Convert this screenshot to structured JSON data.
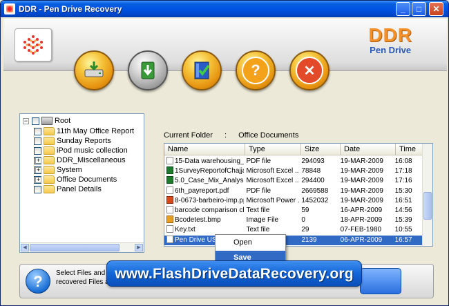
{
  "window": {
    "title": "DDR - Pen Drive Recovery",
    "minimize_label": "_",
    "maximize_label": "□",
    "close_label": "✕"
  },
  "brand": {
    "name": "DDR",
    "product": "Pen Drive"
  },
  "toolbar": {
    "buttons": [
      {
        "icon": "recover-drive-icon"
      },
      {
        "icon": "save-download-icon"
      },
      {
        "icon": "book-check-icon"
      },
      {
        "icon": "help-icon"
      },
      {
        "icon": "exit-icon"
      }
    ]
  },
  "tree": {
    "root_label": "Root",
    "items": [
      {
        "label": "11th May Office Report",
        "expandable": false
      },
      {
        "label": "Sunday Reports",
        "expandable": false
      },
      {
        "label": "iPod music collection",
        "expandable": false
      },
      {
        "label": "DDR_Miscellaneous",
        "expandable": true
      },
      {
        "label": "System",
        "expandable": true
      },
      {
        "label": "Office Documents",
        "expandable": true
      },
      {
        "label": "Panel Details",
        "expandable": false
      }
    ]
  },
  "current_folder": {
    "label": "Current Folder",
    "separator": ":",
    "value": "Office Documents"
  },
  "file_list": {
    "columns": [
      "Name",
      "Type",
      "Size",
      "Date",
      "Time"
    ],
    "rows": [
      {
        "name": "15-Data warehousing_I...",
        "type": "PDF file",
        "size": "294093",
        "date": "19-MAR-2009",
        "time": "16:08",
        "icon": "doc"
      },
      {
        "name": "1SurveyReportofChajja...",
        "type": "Microsoft Excel ...",
        "size": "78848",
        "date": "19-MAR-2009",
        "time": "17:18",
        "icon": "xl"
      },
      {
        "name": "5.0_Case_Mix_Analysis...",
        "type": "Microsoft Excel ...",
        "size": "294400",
        "date": "19-MAR-2009",
        "time": "17:16",
        "icon": "xl"
      },
      {
        "name": "6th_payreport.pdf",
        "type": "PDF file",
        "size": "2669588",
        "date": "19-MAR-2009",
        "time": "15:30",
        "icon": "doc"
      },
      {
        "name": "8-0673-barbeiro-imp.ppt",
        "type": "Microsoft Power ...",
        "size": "1452032",
        "date": "19-MAR-2009",
        "time": "16:51",
        "icon": "ppt"
      },
      {
        "name": "barcode comparison ch...",
        "type": "Text file",
        "size": "59",
        "date": "16-APR-2009",
        "time": "14:56",
        "icon": "doc"
      },
      {
        "name": "Bcodetest.bmp",
        "type": "Image File",
        "size": "0",
        "date": "18-APR-2009",
        "time": "15:39",
        "icon": "bmp"
      },
      {
        "name": "Key.txt",
        "type": "Text file",
        "size": "29",
        "date": "07-FEB-1980",
        "time": "10:55",
        "icon": "doc"
      },
      {
        "name": "Pen Drive USB...",
        "type": "",
        "size": "2139",
        "date": "06-APR-2009",
        "time": "16:57",
        "icon": "doc",
        "selected": true
      }
    ]
  },
  "context_menu": {
    "items": [
      "Open",
      "Save"
    ]
  },
  "help": {
    "text": "Select Files and Fo... recovered Files and..."
  },
  "banner": {
    "text": "www.FlashDriveDataRecovery.org"
  },
  "colors": {
    "accent": "#316ac5",
    "brand_orange": "#f4902a",
    "brand_blue": "#2a57b6",
    "banner_blue": "#1265d8"
  }
}
